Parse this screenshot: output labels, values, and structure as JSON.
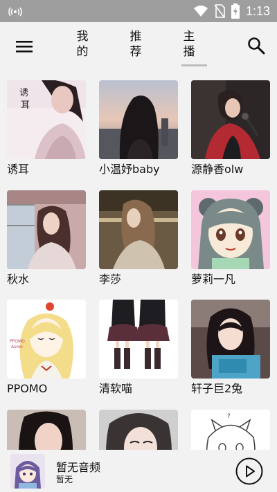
{
  "status_bar": {
    "time": "1:13",
    "icons": [
      "broadcast-icon",
      "wifi-icon",
      "no-sim-icon",
      "battery-charging-icon"
    ]
  },
  "header": {
    "menu_icon": "menu-icon",
    "tabs": [
      {
        "label_line1": "我",
        "label_line2": "的"
      },
      {
        "label_line1": "推",
        "label_line2": "荐"
      },
      {
        "label_line1": "主",
        "label_line2": "播",
        "selected": true
      }
    ],
    "search_icon": "search-icon"
  },
  "anchors": [
    {
      "name": "诱耳"
    },
    {
      "name": "小温妤baby"
    },
    {
      "name": "源静香olw"
    },
    {
      "name": "秋水"
    },
    {
      "name": "李莎"
    },
    {
      "name": "萝莉一凡"
    },
    {
      "name": "PPOMO"
    },
    {
      "name": "清软喵"
    },
    {
      "name": "轩子巨2兔"
    },
    {
      "name": ""
    },
    {
      "name": ""
    },
    {
      "name": ""
    }
  ],
  "player": {
    "title": "暂无音频",
    "artist": "暂无",
    "play_icon": "play-icon"
  },
  "colors": {
    "status_bar": "#9e9e9e",
    "background": "#f2f2f2",
    "tab_indicator": "#bdbdbd"
  }
}
